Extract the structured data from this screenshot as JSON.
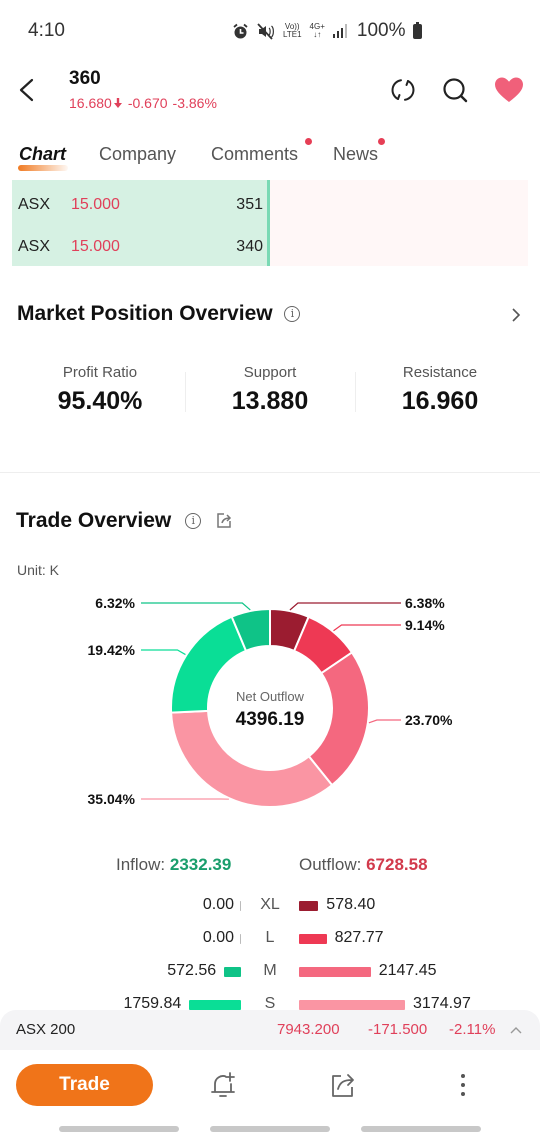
{
  "status_bar": {
    "time": "4:10",
    "icons": [
      "alarm-icon",
      "mute-icon",
      "volte-icon",
      "4g-icon",
      "signal-icon"
    ],
    "volte_top": "Vo))",
    "volte_bottom": "LTE1",
    "net_top": "4G+",
    "net_bottom": "↓↑",
    "battery": "100%"
  },
  "header": {
    "ticker": "360",
    "price": "16.680",
    "change": "-0.670",
    "change_pct": "-3.86%",
    "direction": "down",
    "price_color": "#e0405a",
    "favorite_color": "#f0607a"
  },
  "tabs": [
    {
      "label": "Chart",
      "active": true,
      "badge": false
    },
    {
      "label": "Company",
      "active": false,
      "badge": false
    },
    {
      "label": "Comments",
      "active": false,
      "badge": true
    },
    {
      "label": "News",
      "active": false,
      "badge": true
    }
  ],
  "order_book": {
    "bids": [
      {
        "exchange": "ASX",
        "price": "15.000",
        "qty": "351"
      },
      {
        "exchange": "ASX",
        "price": "15.000",
        "qty": "340"
      }
    ]
  },
  "market_position": {
    "title": "Market Position Overview",
    "metrics": [
      {
        "label": "Profit Ratio",
        "value": "95.40%"
      },
      {
        "label": "Support",
        "value": "13.880"
      },
      {
        "label": "Resistance",
        "value": "16.960"
      }
    ]
  },
  "trade_overview": {
    "title": "Trade Overview",
    "unit": "Unit: K",
    "center_label": "Net Outflow",
    "center_value": "4396.19",
    "inflow_label": "Inflow:",
    "inflow_value": "2332.39",
    "outflow_label": "Outflow:",
    "outflow_value": "6728.58",
    "breakdown": [
      {
        "cat": "XL",
        "inflow": "0.00",
        "outflow": "578.40"
      },
      {
        "cat": "L",
        "inflow": "0.00",
        "outflow": "827.77"
      },
      {
        "cat": "M",
        "inflow": "572.56",
        "outflow": "2147.45"
      },
      {
        "cat": "S",
        "inflow": "1759.84",
        "outflow": "3174.97"
      }
    ],
    "colors": {
      "out_xl": "#9b1c30",
      "out_l": "#ee3954",
      "out_m": "#f4687f",
      "out_s": "#fa95a3",
      "in_s": "#0ade96",
      "in_m": "#0fc387"
    }
  },
  "chart_data": {
    "type": "pie",
    "title": "Trade Overview",
    "subtitle": "Unit: K",
    "center_text": [
      "Net Outflow",
      "4396.19"
    ],
    "slices": [
      {
        "name": "Outflow XL",
        "value": 6.38,
        "label": "6.38%",
        "color": "#9b1c30"
      },
      {
        "name": "Outflow L",
        "value": 9.14,
        "label": "9.14%",
        "color": "#ee3954"
      },
      {
        "name": "Outflow M",
        "value": 23.7,
        "label": "23.70%",
        "color": "#f4687f"
      },
      {
        "name": "Outflow S",
        "value": 35.04,
        "label": "35.04%",
        "color": "#fa95a3"
      },
      {
        "name": "Inflow S",
        "value": 19.42,
        "label": "19.42%",
        "color": "#0ade96"
      },
      {
        "name": "Inflow M",
        "value": 6.32,
        "label": "6.32%",
        "color": "#0fc387"
      }
    ],
    "start": "12 o'clock",
    "direction": "clockwise"
  },
  "index_bar": {
    "name": "ASX 200",
    "value": "7943.200",
    "change": "-171.500",
    "change_pct": "-2.11%"
  },
  "bottom_bar": {
    "trade_label": "Trade"
  }
}
